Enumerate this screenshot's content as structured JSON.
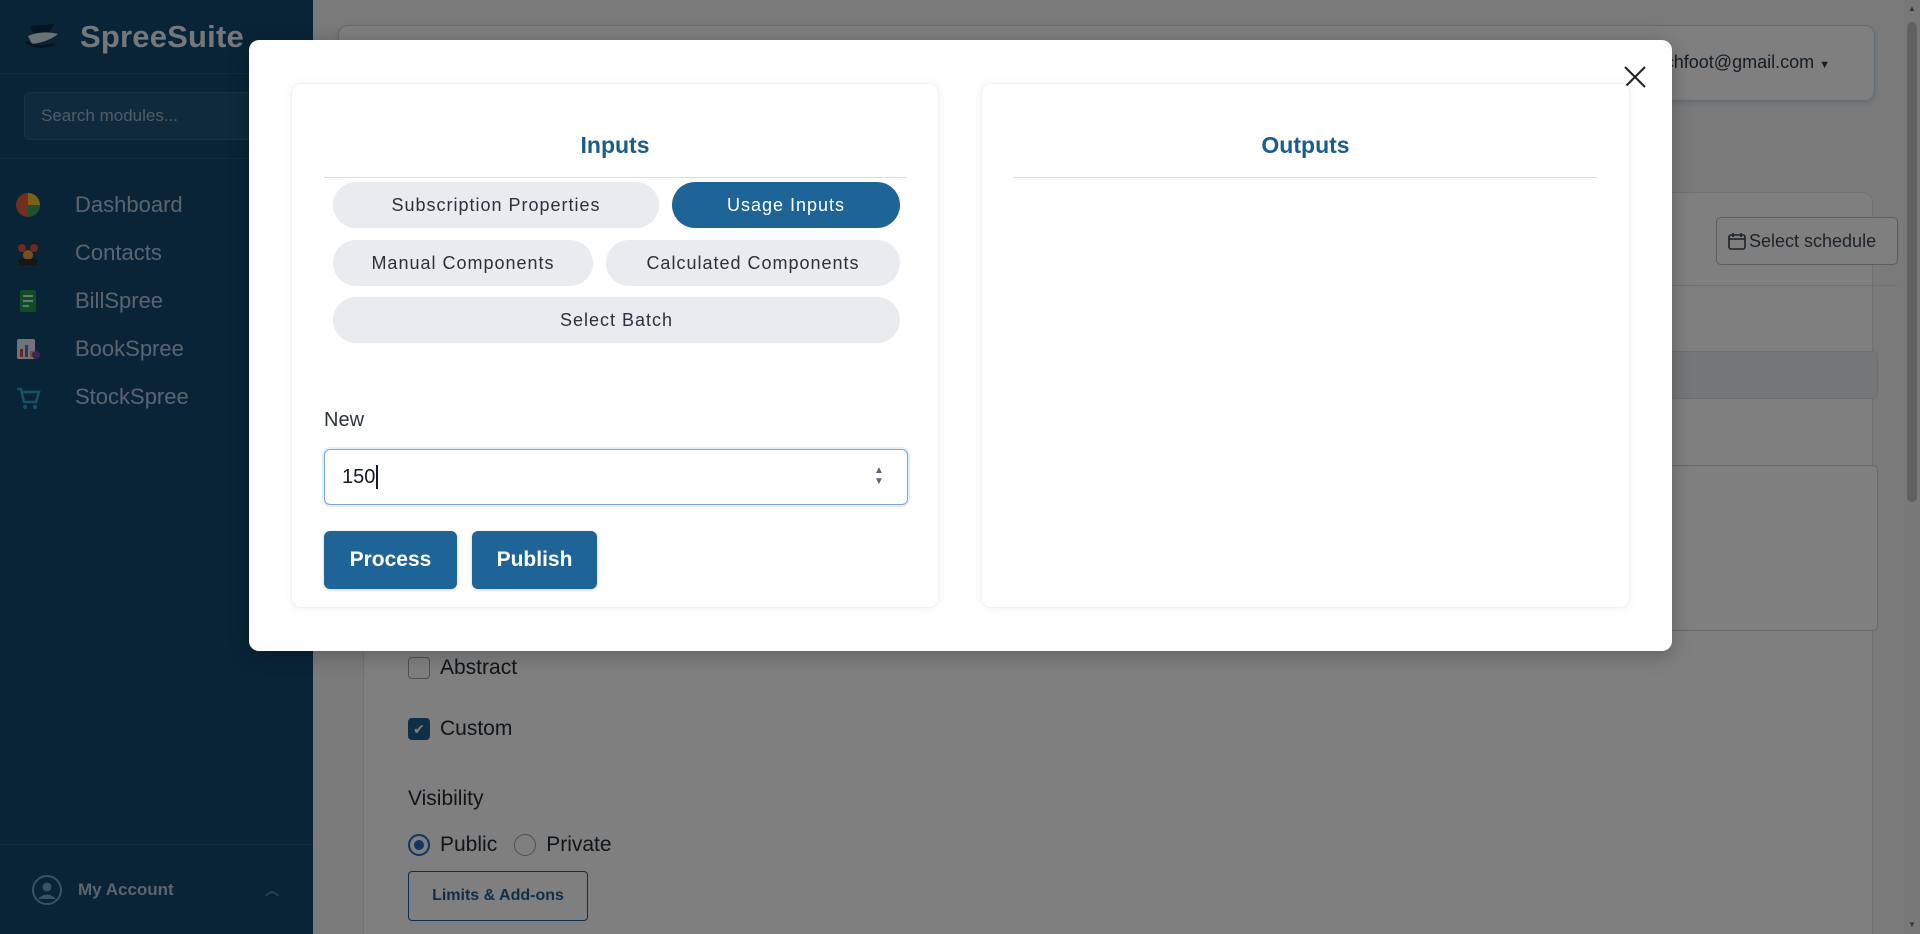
{
  "app": {
    "name": "SpreeSuite"
  },
  "sidebar": {
    "search_placeholder": "Search modules...",
    "items": [
      {
        "label": "Dashboard",
        "icon": "dashboard-icon"
      },
      {
        "label": "Contacts",
        "icon": "contacts-icon"
      },
      {
        "label": "BillSpree",
        "icon": "billspree-icon"
      },
      {
        "label": "BookSpree",
        "icon": "bookspree-icon"
      },
      {
        "label": "StockSpree",
        "icon": "stockspree-icon"
      }
    ],
    "account_label": "My Account"
  },
  "header": {
    "user_email": "chfoot@gmail.com"
  },
  "background_form": {
    "schedule_button": "Select schedule",
    "checkbox_abstract": "Abstract",
    "checkbox_custom": "Custom",
    "visibility_label": "Visibility",
    "radio_public": "Public",
    "radio_private": "Private",
    "limits_button": "Limits & Add-ons"
  },
  "modal": {
    "inputs_title": "Inputs",
    "outputs_title": "Outputs",
    "tabs": [
      {
        "label": "Subscription Properties",
        "active": false
      },
      {
        "label": "Usage Inputs",
        "active": true
      },
      {
        "label": "Manual Components",
        "active": false
      },
      {
        "label": "Calculated Components",
        "active": false
      },
      {
        "label": "Select Batch",
        "active": false
      }
    ],
    "field_label": "New",
    "field_value": "150",
    "process_button": "Process",
    "publish_button": "Publish"
  },
  "colors": {
    "sidebar_bg": "#13486e",
    "primary": "#1f6497",
    "title": "#1b5d8a"
  }
}
